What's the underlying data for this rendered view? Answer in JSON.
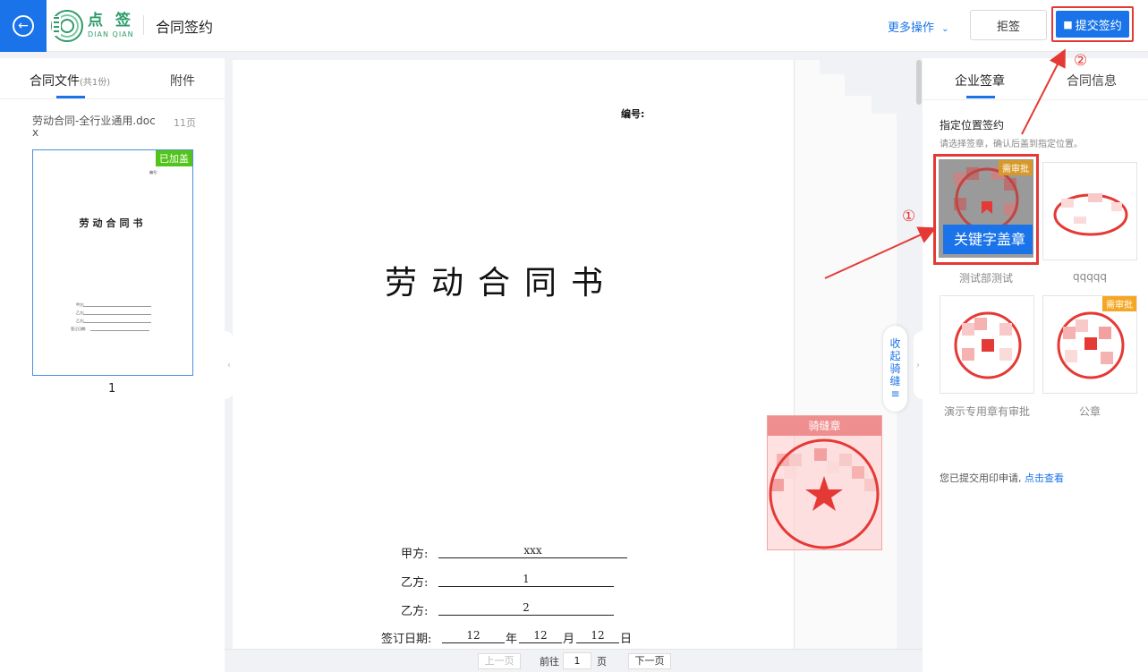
{
  "header": {
    "logo_cn": "点 签",
    "logo_en": "DIAN QIAN",
    "title": "合同签约",
    "more_ops": "更多操作",
    "reject": "拒签",
    "submit": "提交签约"
  },
  "left": {
    "tab_files": "合同文件",
    "tab_files_count": "(共1份)",
    "tab_attachments": "附件",
    "file_name": "劳动合同-全行业通用.docx",
    "file_pages": "11页",
    "thumb_badge": "已加盖",
    "thumb_no": "编号:",
    "thumb_title": "劳动合同书",
    "thumb_page_num": "1",
    "thumb_labels": [
      "甲方:",
      "乙方:",
      "乙方:",
      "签订日期:"
    ]
  },
  "document": {
    "number_label": "编号:",
    "title": "劳动合同书",
    "fields": [
      {
        "label": "甲方:",
        "value": "xxx"
      },
      {
        "label": "乙方:",
        "value": "1"
      },
      {
        "label": "乙方:",
        "value": "2"
      }
    ],
    "date_label": "签订日期:",
    "date_year": "12",
    "date_month": "12",
    "date_day": "12",
    "year_char": "年",
    "month_char": "月",
    "day_char": "日"
  },
  "qifeng": {
    "collapse_label": "收起骑缝",
    "seal_title": "骑缝章"
  },
  "pager": {
    "prev": "上一页",
    "goto": "前往",
    "page": "1",
    "unit": "页",
    "next": "下一页"
  },
  "right": {
    "tab_seal": "企业签章",
    "tab_info": "合同信息",
    "section_title": "指定位置签约",
    "section_hint": "请选择签章，确认后盖到指定位置。",
    "seals": [
      {
        "name": "测试部测试",
        "badge": "需审批",
        "selected": true
      },
      {
        "name": "qqqqq",
        "badge": ""
      },
      {
        "name": "演示专用章有审批",
        "badge": ""
      },
      {
        "name": "公章",
        "badge": "需审批"
      }
    ],
    "keyword_button": "关键字盖章",
    "applied_text": "您已提交用印申请,",
    "applied_link": "点击查看"
  },
  "annotations": {
    "one": "①",
    "two": "②"
  },
  "colors": {
    "primary": "#1a73e8",
    "annotation_red": "#e53935",
    "badge_green": "#52c41a",
    "badge_orange": "#f5a623",
    "brand_green": "#2e9b6a"
  }
}
